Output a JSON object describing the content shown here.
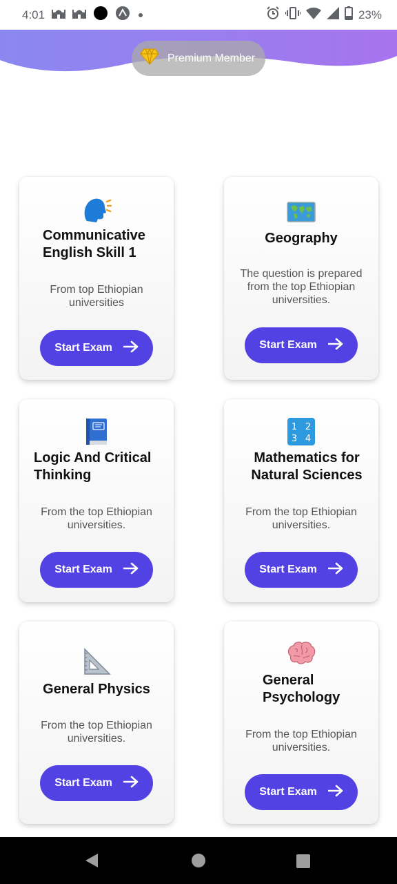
{
  "status_bar": {
    "time": "4:01",
    "battery": "23%"
  },
  "header": {
    "premium_label": "Premium Member",
    "gradient_start": "#8a88f0",
    "gradient_end": "#a774ee"
  },
  "accent_color": "#5241e3",
  "cards": [
    {
      "icon": "speaking-head-icon",
      "title": "Communicative English Skill 1",
      "description": "From top Ethiopian universities",
      "button_label": "Start Exam"
    },
    {
      "icon": "world-map-icon",
      "title": "Geography",
      "description": "The question is prepared from the top Ethiopian universities.",
      "button_label": "Start Exam"
    },
    {
      "icon": "blue-book-icon",
      "title": "Logic And  Critical Thinking",
      "description": "From the top Ethiopian universities.",
      "button_label": "Start Exam"
    },
    {
      "icon": "numbers-1234-icon",
      "title": "Mathematics for Natural Sciences",
      "description": "From the top Ethiopian universities.",
      "button_label": "Start Exam"
    },
    {
      "icon": "triangular-ruler-icon",
      "title": "General Physics",
      "description": "From the top Ethiopian universities.",
      "button_label": "Start Exam"
    },
    {
      "icon": "brain-icon",
      "title": "General Psychology",
      "description": "From the top Ethiopian universities.",
      "button_label": "Start Exam"
    }
  ]
}
